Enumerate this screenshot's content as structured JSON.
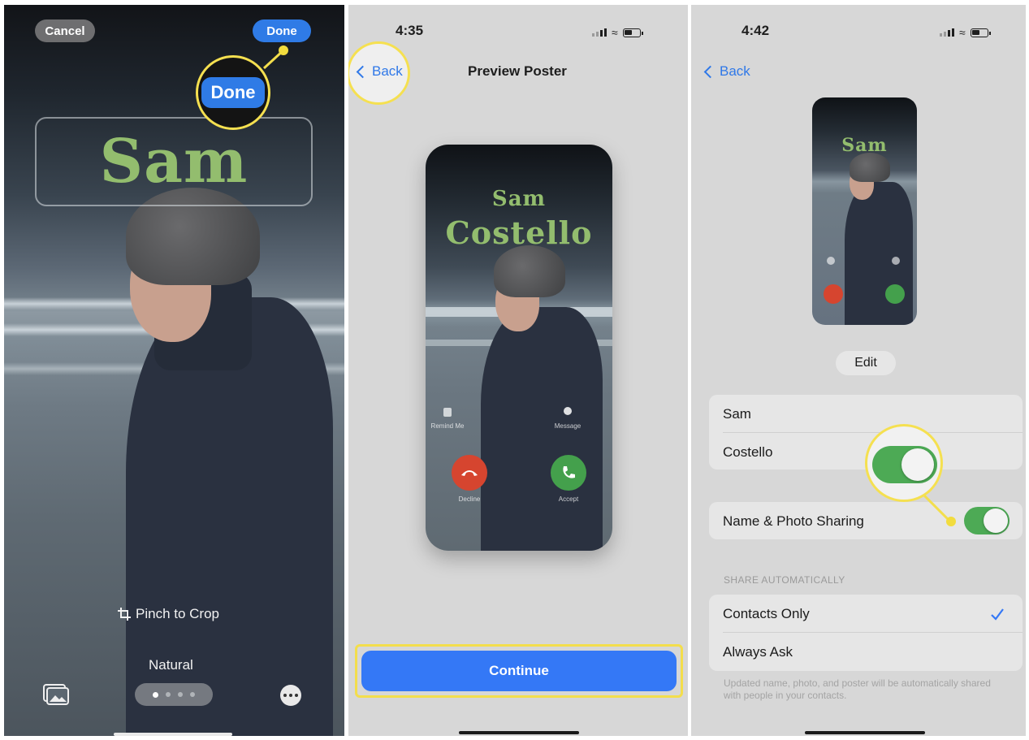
{
  "panel1": {
    "cancel_label": "Cancel",
    "done_label": "Done",
    "done_zoom_label": "Done",
    "poster_name": "Sam",
    "pinch_label": "Pinch to Crop",
    "style_label": "Natural",
    "icons": {
      "crop": "crop-icon",
      "photo": "photo-library-icon",
      "more": "more-icon"
    }
  },
  "panel2": {
    "time": "4:35",
    "back_label": "Back",
    "title": "Preview Poster",
    "poster_first": "Sam",
    "poster_last": "Costello",
    "remind_label": "Remind Me",
    "message_label": "Message",
    "decline_label": "Decline",
    "accept_label": "Accept",
    "continue_label": "Continue"
  },
  "panel3": {
    "time": "4:42",
    "back_label": "Back",
    "poster_name": "Sam",
    "edit_label": "Edit",
    "first_name": "Sam",
    "last_name": "Costello",
    "sharing_label": "Name & Photo Sharing",
    "sharing_on": true,
    "share_header": "SHARE AUTOMATICALLY",
    "option_contacts": "Contacts Only",
    "option_ask": "Always Ask",
    "selected_option": "Contacts Only",
    "footer": "Updated name, photo, and poster will be automatically shared with people in your contacts."
  },
  "colors": {
    "ios_blue": "#3478f6",
    "toggle_green": "#4daa55",
    "highlight_yellow": "#f3de4c",
    "poster_green": "#93bd6e",
    "decline_red": "#d6452f",
    "accept_green": "#44a04c"
  }
}
